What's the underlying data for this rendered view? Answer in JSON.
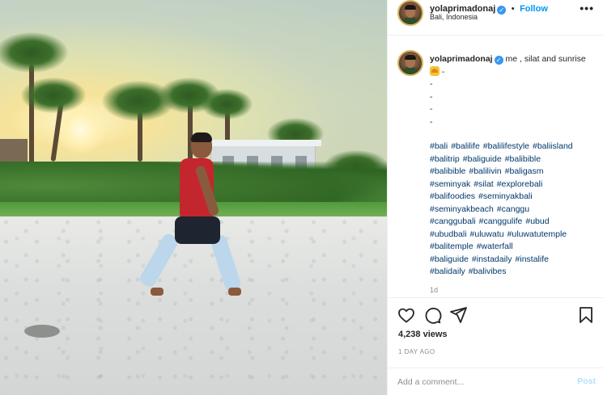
{
  "header": {
    "username": "yolaprimadonaj",
    "separator": "•",
    "follow_label": "Follow",
    "location": "Bali, Indonesia",
    "more_label": "•••"
  },
  "caption": {
    "username": "yolaprimadonaj",
    "text": "me , silat and sunrise",
    "text_after_emoji": "-",
    "dashes": [
      "-",
      "-",
      "-",
      "-"
    ],
    "emoji": "sunrise-emoji"
  },
  "hashtags": [
    "#bali",
    "#balilife",
    "#balilifestyle",
    "#baliisland",
    "#balitrip",
    "#baliguide",
    "#balibible",
    "#balibible",
    "#balilivin",
    "#baligasm",
    "#seminyak",
    "#silat",
    "#explorebali",
    "#balifoodies",
    "#seminyakbali",
    "#seminyakbeach",
    "#canggu",
    "#canggubali",
    "#canggulife",
    "#ubud",
    "#ubudbali",
    "#uluwatu",
    "#uluwatutemple",
    "#balitemple",
    "#waterfall",
    "#baliguide",
    "#instadaily",
    "#instalife",
    "#balidaily",
    "#balivibes"
  ],
  "time_ago": "1d",
  "stats": {
    "views": "4,238 views",
    "date": "1 DAY AGO"
  },
  "comment_box": {
    "placeholder": "Add a comment...",
    "post_label": "Post"
  },
  "icons": {
    "like": "heart-icon",
    "comment": "comment-icon",
    "share": "send-icon",
    "save": "bookmark-icon",
    "verified": "verified-badge-icon"
  },
  "colors": {
    "link": "#00376b",
    "follow": "#0095f6",
    "verified": "#3897f0",
    "muted": "#8e8e8e",
    "post_disabled": "#b2dffc"
  }
}
